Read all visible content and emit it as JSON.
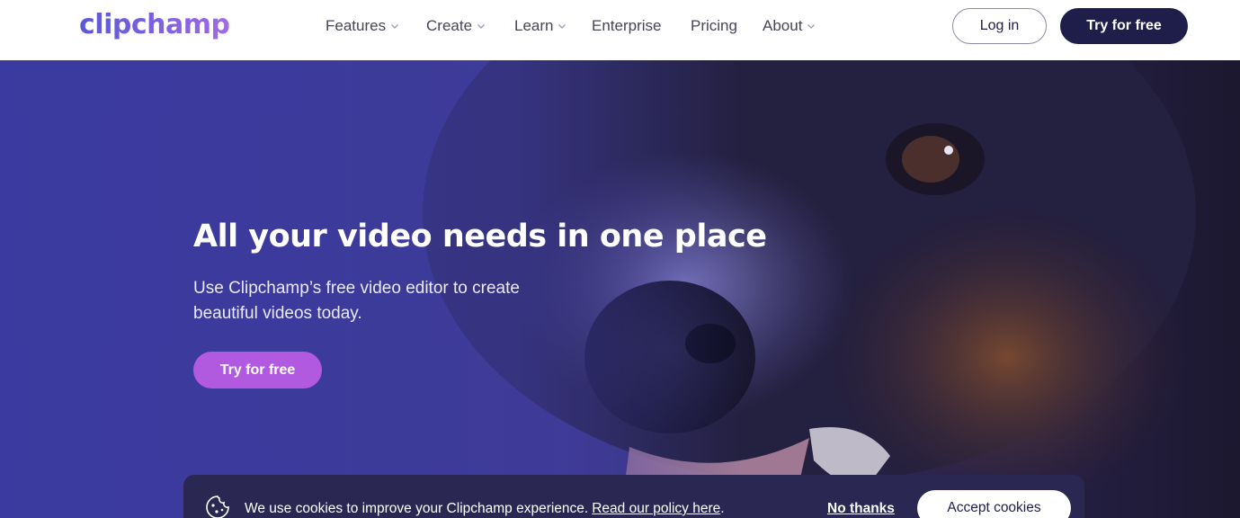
{
  "header": {
    "logo": "clipchamp",
    "nav": [
      {
        "label": "Features",
        "dropdown": true
      },
      {
        "label": "Create",
        "dropdown": true
      },
      {
        "label": "Learn",
        "dropdown": true
      },
      {
        "label": "Enterprise",
        "dropdown": false
      },
      {
        "label": "Pricing",
        "dropdown": false
      },
      {
        "label": "About",
        "dropdown": true
      }
    ],
    "login_label": "Log in",
    "try_label": "Try for free"
  },
  "hero": {
    "title": "All your video needs in one place",
    "subtitle": "Use Clipchamp’s free video editor to create beautiful videos today.",
    "cta_label": "Try for free"
  },
  "cookie_banner": {
    "text": "We use cookies to improve your Clipchamp experience.",
    "link": "Read our policy here",
    "link_suffix": ".",
    "decline_label": "No thanks",
    "accept_label": "Accept cookies",
    "icon": "cookie-icon"
  },
  "colors": {
    "brand_dark": "#1f1d4a",
    "accent_purple": "#b15ae0",
    "hero_base": "#3e3a93"
  }
}
